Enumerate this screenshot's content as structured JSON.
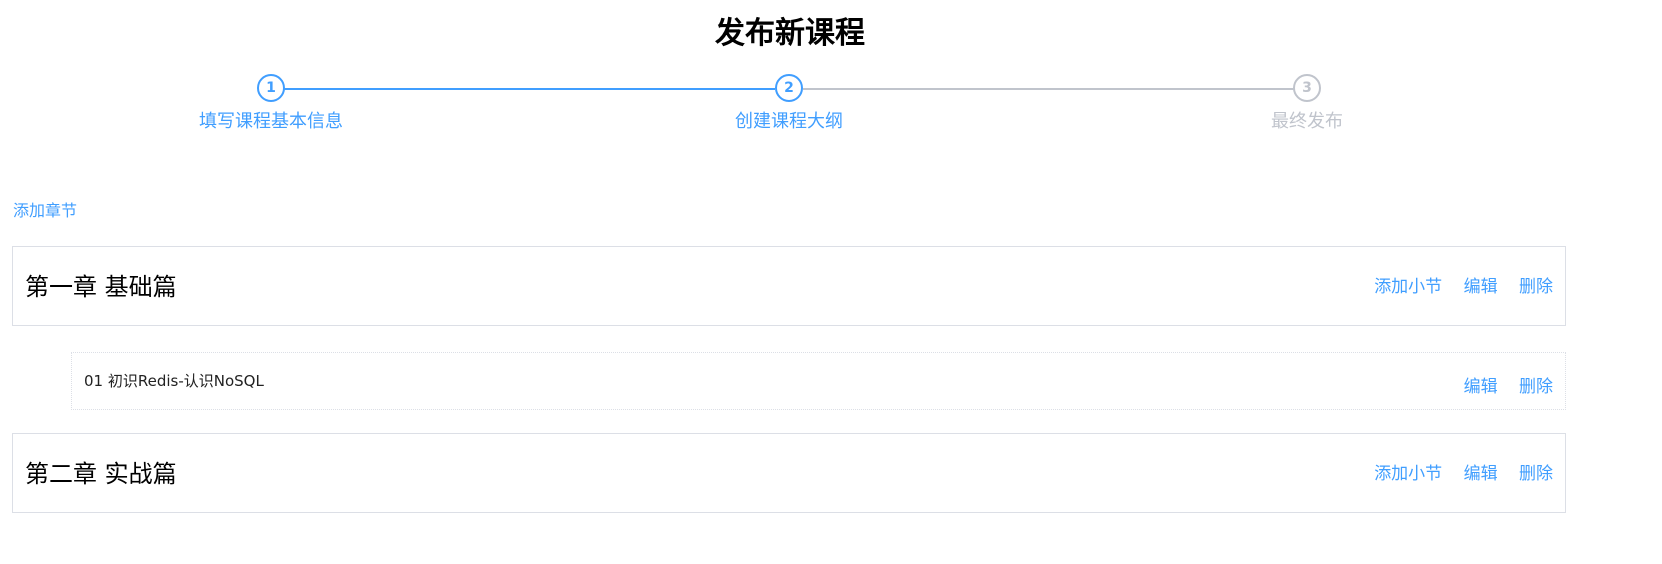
{
  "page": {
    "title": "发布新课程"
  },
  "steps": [
    {
      "number": "1",
      "label": "填写课程基本信息",
      "status": "done"
    },
    {
      "number": "2",
      "label": "创建课程大纲",
      "status": "active"
    },
    {
      "number": "3",
      "label": "最终发布",
      "status": "pending"
    }
  ],
  "outline": {
    "add_chapter_label": "添加章节",
    "chapters": [
      {
        "title": "第一章 基础篇",
        "add_section_label": "添加小节",
        "edit_label": "编辑",
        "delete_label": "删除",
        "sections": [
          {
            "title": "01 初识Redis-认识NoSQL",
            "edit_label": "编辑",
            "delete_label": "删除"
          }
        ]
      },
      {
        "title": "第二章 实战篇",
        "add_section_label": "添加小节",
        "edit_label": "编辑",
        "delete_label": "删除",
        "sections": []
      }
    ]
  },
  "colors": {
    "accent": "#409eff",
    "inactive": "#c0c4cc",
    "border": "#dcdfe6"
  }
}
